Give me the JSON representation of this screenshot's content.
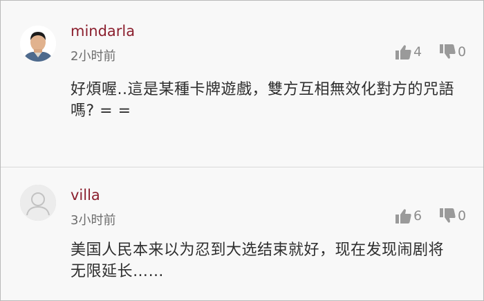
{
  "comments": [
    {
      "username": "mindarla",
      "time": "2小时前",
      "text": "好煩喔..這是某種卡牌遊戲，雙方互相無效化對方的咒語嗎? = =",
      "likes": "4",
      "dislikes": "0",
      "avatar_icon": "user-photo-avatar"
    },
    {
      "username": "villa",
      "time": "3小时前",
      "text": "美国人民本来以为忍到大选结束就好，现在发现闹剧将无限延长……",
      "likes": "6",
      "dislikes": "0",
      "avatar_icon": "default-user-avatar"
    }
  ],
  "colors": {
    "username": "#8b1f2e",
    "background": "#f8f8f8",
    "text": "#2e2e2e",
    "meta": "#8d8d8d"
  }
}
